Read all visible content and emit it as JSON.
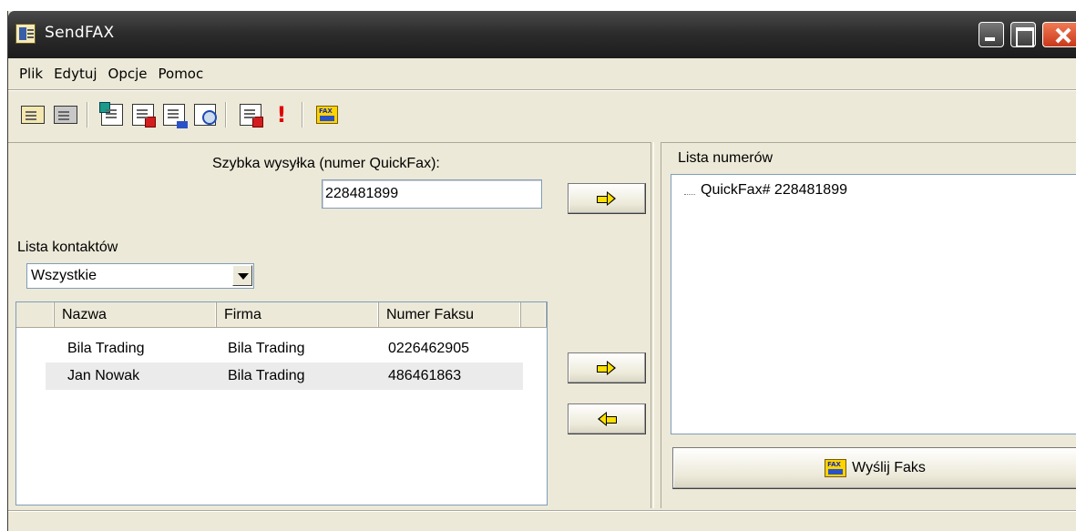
{
  "window": {
    "title": "SendFAX"
  },
  "menu": [
    "Plik",
    "Edytuj",
    "Opcje",
    "Pomoc"
  ],
  "toolbar": {
    "icons": [
      "contact-card-icon",
      "contact-image-icon",
      "new-document-icon",
      "delete-document-icon",
      "copy-document-icon",
      "preview-icon",
      "add-document-icon",
      "priority-icon",
      "send-fax-icon"
    ],
    "priority_glyph": "!"
  },
  "quickfax": {
    "label": "Szybka wysyłka (numer QuickFax):",
    "value": "228481899"
  },
  "contacts": {
    "label": "Lista kontaktów",
    "filter_value": "Wszystkie",
    "columns": [
      "Nazwa",
      "Firma",
      "Numer Faksu"
    ],
    "rows": [
      {
        "name": "Bila Trading",
        "company": "Bila Trading",
        "fax": "0226462905"
      },
      {
        "name": "Jan Nowak",
        "company": "Bila Trading",
        "fax": "486461863"
      }
    ]
  },
  "numbers": {
    "label": "Lista numerów",
    "items": [
      "QuickFax# 228481899"
    ]
  },
  "send_button": {
    "label": "Wyślij Faks"
  }
}
